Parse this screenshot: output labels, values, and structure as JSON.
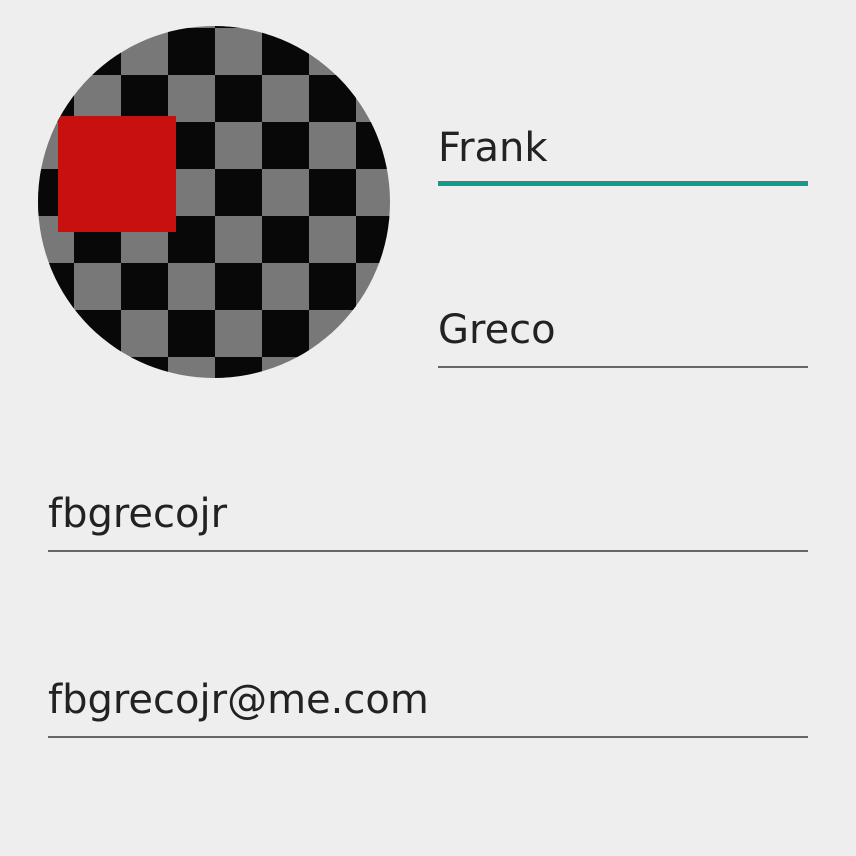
{
  "profile": {
    "avatar": {
      "icon": "profile-photo-placeholder",
      "colors": {
        "dark_square": "#080808",
        "light_square": "#787878",
        "overlay": "#c8100f"
      }
    },
    "first_name": {
      "value": "Frank",
      "focused": true
    },
    "last_name": {
      "value": "Greco",
      "focused": false
    },
    "username": {
      "value": "fbgrecojr",
      "focused": false
    },
    "email": {
      "value": "fbgrecojr@me.com",
      "focused": false
    }
  },
  "theme": {
    "background": "#eeeeee",
    "accent": "#129a8a",
    "text": "#222222",
    "divider": "#666666"
  }
}
